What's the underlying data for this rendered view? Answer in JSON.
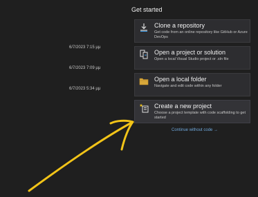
{
  "recent": [
    {
      "date": "6/7/2023 7:15 μμ"
    },
    {
      "date": "6/7/2023 7:09 μμ"
    },
    {
      "date": "6/7/2023 5:34 μμ"
    }
  ],
  "get_started": {
    "title": "Get started",
    "cards": [
      {
        "title": "Clone a repository",
        "description": "Get code from an online repository like GitHub or Azure DevOps",
        "icon": "clone-icon"
      },
      {
        "title": "Open a project or solution",
        "description": "Open a local Visual Studio project or .sln file",
        "icon": "open-project-icon"
      },
      {
        "title": "Open a local folder",
        "description": "Navigate and edit code within any folder",
        "icon": "folder-icon"
      },
      {
        "title": "Create a new project",
        "description": "Choose a project template with code scaffolding to get started",
        "icon": "new-project-icon"
      }
    ],
    "continue_link": "Continue without code →"
  },
  "annotation": {
    "color": "#f2c418",
    "icon": "arrow-annotation"
  }
}
